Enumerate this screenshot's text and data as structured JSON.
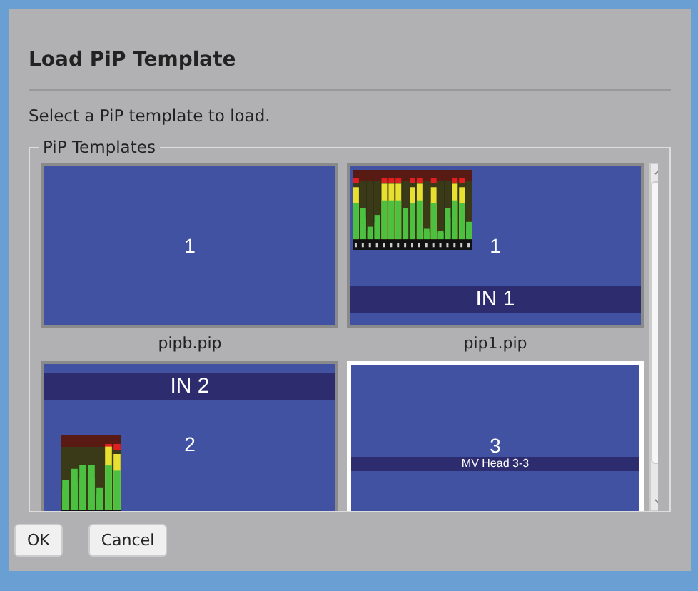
{
  "dialog": {
    "title": "Load PiP Template",
    "instruction": "Select a PiP template to load."
  },
  "group": {
    "legend": "PiP Templates"
  },
  "templates": [
    {
      "kind": "blank",
      "number": "1",
      "name": "pipb.pip",
      "selected": false
    },
    {
      "kind": "metered",
      "number": "1",
      "name": "pip1.pip",
      "selected": false,
      "banner": "IN 1"
    },
    {
      "kind": "headed",
      "number": "2",
      "selected": false,
      "banner": "IN 2"
    },
    {
      "kind": "captioned",
      "number": "3",
      "selected": true,
      "banner": "MV Head 3-3"
    }
  ],
  "buttons": [
    {
      "label": "OK"
    },
    {
      "label": "Cancel"
    }
  ]
}
